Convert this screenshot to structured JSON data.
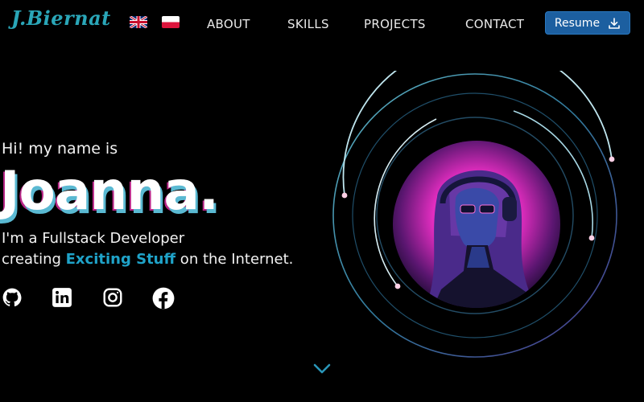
{
  "header": {
    "logo": "J.Biernat",
    "languages": [
      {
        "name": "uk-flag-icon"
      },
      {
        "name": "pl-flag-icon"
      }
    ],
    "nav": {
      "about": "ABOUT",
      "skills": "SKILLS",
      "projects": "PROJECTS",
      "contact": "CONTACT"
    },
    "resume_label": "Resume",
    "resume_icon": "download-icon"
  },
  "hero": {
    "greeting": "Hi! my name is",
    "name": "Joanna.",
    "role": "I'm a Fullstack Developer",
    "tagline_before": "creating ",
    "tagline_highlight": "Exciting Stuff",
    "tagline_after": " on the Internet."
  },
  "social": [
    "github-icon",
    "linkedin-icon",
    "instagram-icon",
    "facebook-icon"
  ],
  "colors": {
    "background": "#000000",
    "accent": "#1fa3c9",
    "logo": "#2aa6b8",
    "button": "#1c5fa0",
    "glow_pink": "#e32dc0"
  },
  "scroll_icon": "chevron-down-icon"
}
